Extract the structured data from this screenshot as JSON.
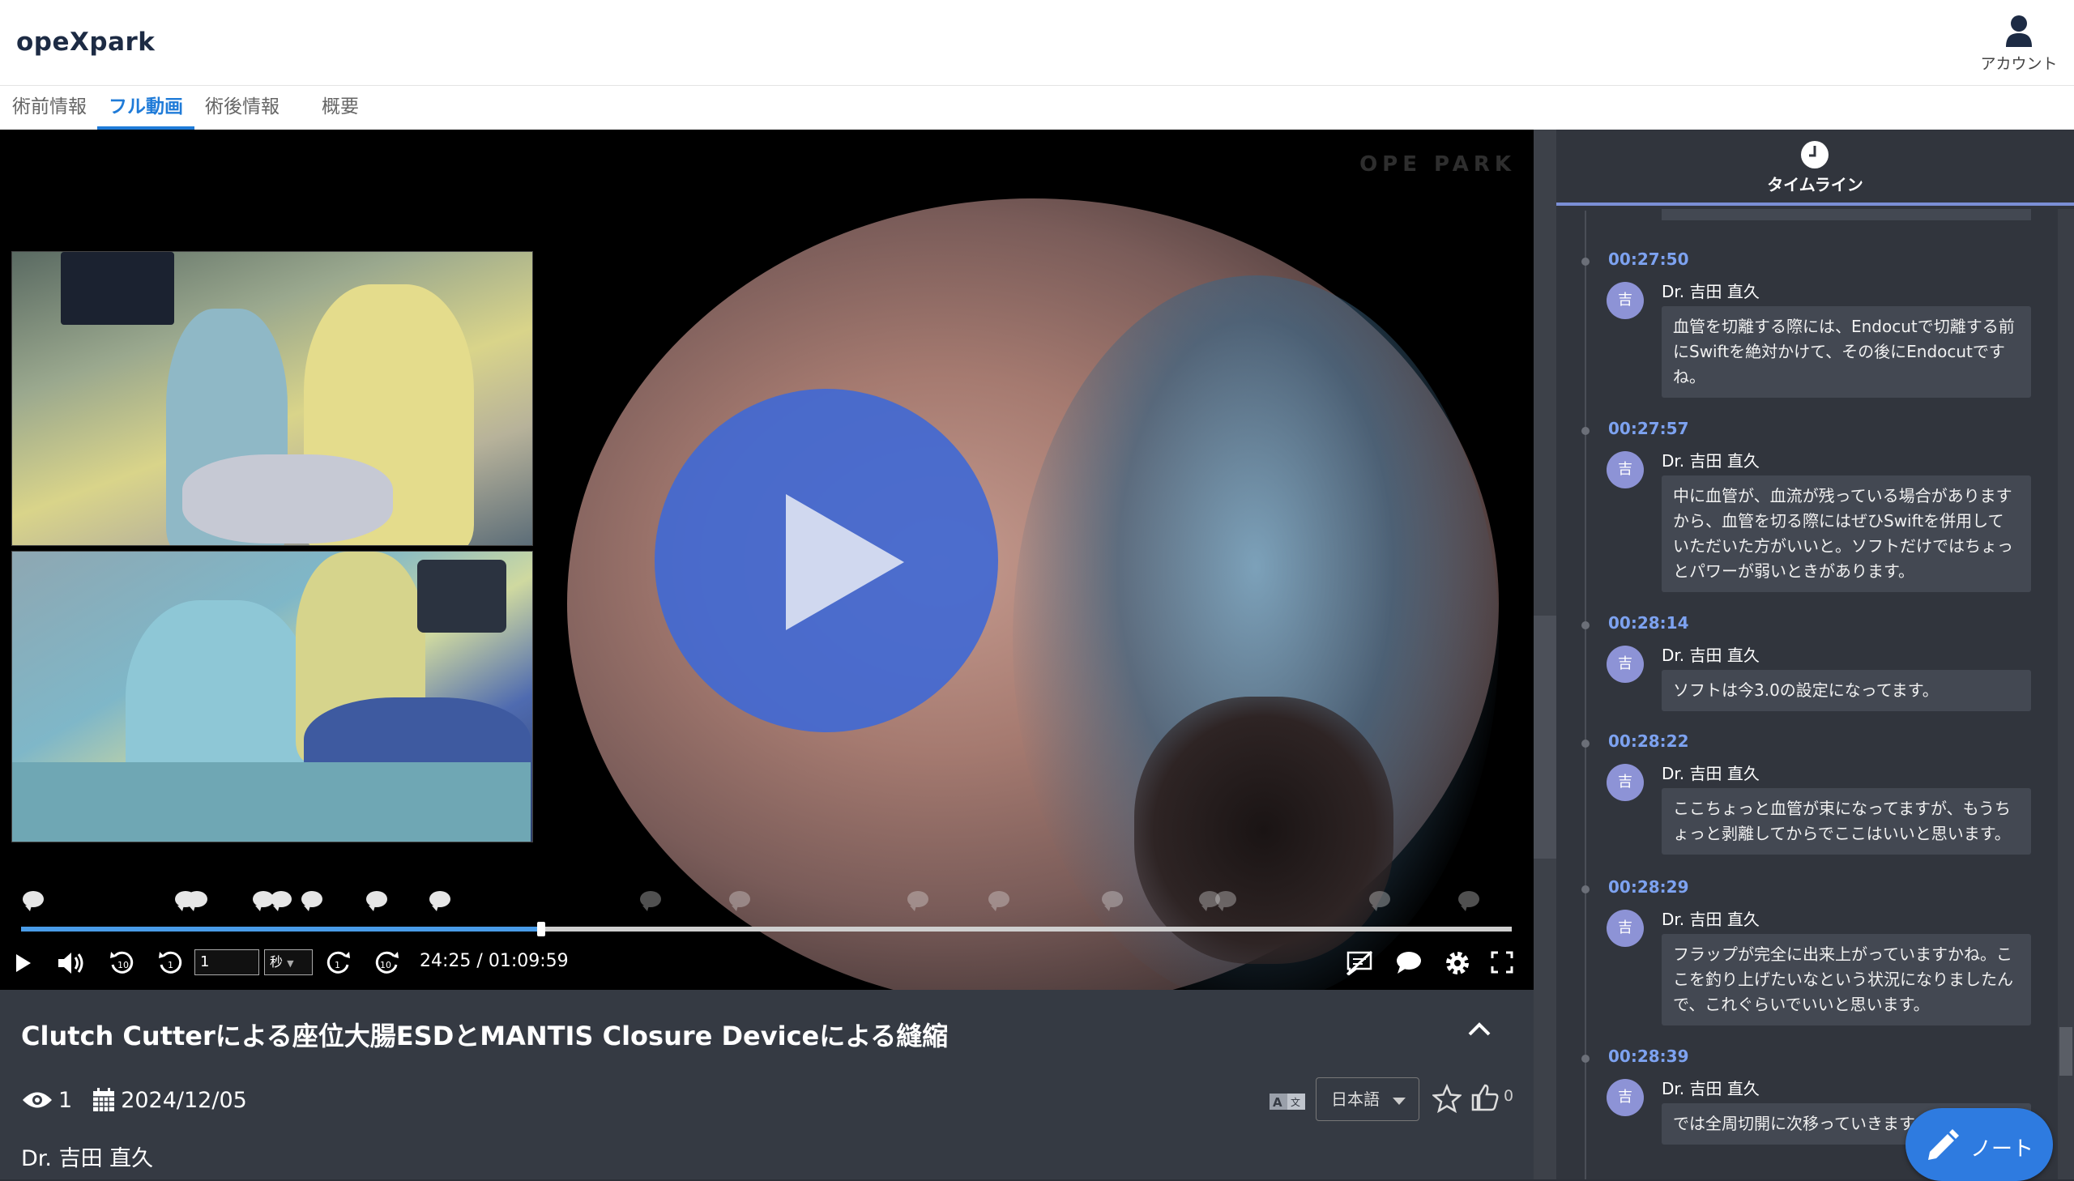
{
  "app": {
    "logo": "opeXpark",
    "account_label": "アカウント"
  },
  "tabs": [
    {
      "label": "術前情報",
      "active": false
    },
    {
      "label": "フル動画",
      "active": true
    },
    {
      "label": "術後情報",
      "active": false
    },
    {
      "label": "概要",
      "active": false
    }
  ],
  "player": {
    "watermark": "OPE PARK",
    "seek_step_value": "1",
    "seek_unit": "秒",
    "current_time": "24:25",
    "separator": "/",
    "duration": "01:09:59",
    "progress_fraction": 0.349
  },
  "video_info": {
    "title": "Clutch Cutterによる座位大腸ESDとMANTIS Closure Deviceによる縫縮",
    "views": "1",
    "date": "2024/12/05",
    "author": "Dr. 吉田 直久",
    "language": "日本語",
    "likes": "0"
  },
  "timeline": {
    "header": "タイムライン",
    "entries": [
      {
        "time": "00:27:50",
        "avatar": "吉",
        "name": "Dr. 吉田 直久",
        "text": "血管を切離する際には、Endocutで切離する前にSwiftを絶対かけて、その後にEndocutですね。"
      },
      {
        "time": "00:27:57",
        "avatar": "吉",
        "name": "Dr. 吉田 直久",
        "text": "中に血管が、血流が残っている場合がありますから、血管を切る際にはぜひSwiftを併用していただいた方がいいと。ソフトだけではちょっとパワーが弱いときがあります。"
      },
      {
        "time": "00:28:14",
        "avatar": "吉",
        "name": "Dr. 吉田 直久",
        "text": "ソフトは今3.0の設定になってます。"
      },
      {
        "time": "00:28:22",
        "avatar": "吉",
        "name": "Dr. 吉田 直久",
        "text": "ここちょっと血管が束になってますが、もうちょっと剥離してからでここはいいと思います。"
      },
      {
        "time": "00:28:29",
        "avatar": "吉",
        "name": "Dr. 吉田 直久",
        "text": "フラップが完全に出来上がっていますかね。ここを釣り上げたいなという状況になりましたんで、これぐらいでいいと思います。"
      },
      {
        "time": "00:28:39",
        "avatar": "吉",
        "name": "Dr. 吉田 直久",
        "text": "では全周切開に次移っていきます。"
      }
    ]
  },
  "note_button": {
    "label": "ノート"
  },
  "colors": {
    "accent": "#1f7bd8",
    "play": "#4269d2",
    "timestamp": "#7da2f0",
    "panel_bg": "#31353d"
  }
}
